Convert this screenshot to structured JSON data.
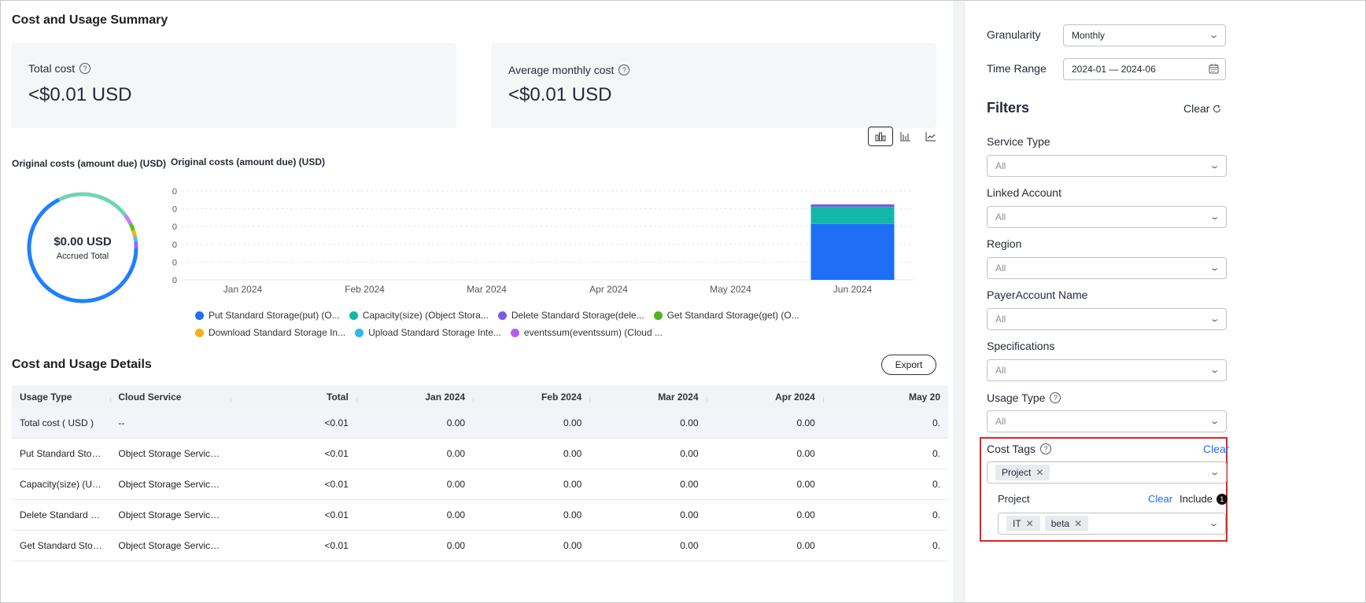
{
  "summary": {
    "title": "Cost and Usage Summary",
    "total_cost_label": "Total cost",
    "total_cost_value": "<$0.01 USD",
    "avg_cost_label": "Average monthly cost",
    "avg_cost_value": "<$0.01 USD"
  },
  "chart_switch": [
    "bar-chart-icon",
    "stacked-bar-icon",
    "line-chart-icon"
  ],
  "chart_data": [
    {
      "type": "pie",
      "title": "Original costs (amount due) (USD)",
      "center_value": "$0.00 USD",
      "center_label": "Accrued Total",
      "categories": [
        "Put Standard Storage(put) (O...",
        "Capacity(size) (Object Stora...",
        "Delete Standard Storage(dele...",
        "Get Standard Storage(get) (O...",
        "Download Standard Storage In...",
        "Upload Standard Storage Inte...",
        "eventssum(eventssum) (Cloud ..."
      ],
      "values": [
        68,
        22,
        3,
        2,
        2,
        1.5,
        1.5
      ],
      "colors": [
        "#1e80ff",
        "#6fd6b2",
        "#c77dfa",
        "#52c41a",
        "#faad14",
        "#4fc0f5",
        "#8f6cf5"
      ]
    },
    {
      "type": "bar",
      "title": "Original costs (amount due) (USD)",
      "categories": [
        "Jan 2024",
        "Feb 2024",
        "Mar 2024",
        "Apr 2024",
        "May 2024",
        "Jun 2024"
      ],
      "y_tick_labels": [
        "0",
        "0",
        "0",
        "0",
        "0",
        "0"
      ],
      "ylim": [
        0,
        100
      ],
      "series": [
        {
          "name": "Put Standard Storage(put) (O...",
          "color": "#1e6ff6",
          "values": [
            0,
            0,
            0,
            0,
            0,
            63
          ]
        },
        {
          "name": "Capacity(size) (Object Stora...",
          "color": "#13b7a8",
          "values": [
            0,
            0,
            0,
            0,
            0,
            19
          ]
        },
        {
          "name": "Delete Standard Storage(dele...",
          "color": "#7b5ce1",
          "values": [
            0,
            0,
            0,
            0,
            0,
            3
          ]
        },
        {
          "name": "Get Standard Storage(get) (O...",
          "color": "#52b31b",
          "values": [
            0,
            0,
            0,
            0,
            0,
            0
          ]
        },
        {
          "name": "Download Standard Storage In...",
          "color": "#faad14",
          "values": [
            0,
            0,
            0,
            0,
            0,
            0
          ]
        },
        {
          "name": "Upload Standard Storage Inte...",
          "color": "#34b6f0",
          "values": [
            0,
            0,
            0,
            0,
            0,
            0
          ]
        },
        {
          "name": "eventssum(eventssum) (Cloud ...",
          "color": "#b35ef2",
          "values": [
            0,
            0,
            0,
            0,
            0,
            0
          ]
        }
      ]
    }
  ],
  "details": {
    "title": "Cost and Usage Details",
    "export_label": "Export",
    "columns": [
      "Usage Type",
      "Cloud Service",
      "Total",
      "Jan 2024",
      "Feb 2024",
      "Mar 2024",
      "Apr 2024",
      "May 20"
    ],
    "rows": [
      [
        "Total cost ( USD )",
        "--",
        "<0.01",
        "0.00",
        "0.00",
        "0.00",
        "0.00",
        "0."
      ],
      [
        "Put Standard Stora...",
        "Object Storage Service (O...",
        "<0.01",
        "0.00",
        "0.00",
        "0.00",
        "0.00",
        "0."
      ],
      [
        "Capacity(size) (USD)",
        "Object Storage Service (O...",
        "<0.01",
        "0.00",
        "0.00",
        "0.00",
        "0.00",
        "0."
      ],
      [
        "Delete Standard St...",
        "Object Storage Service (O...",
        "<0.01",
        "0.00",
        "0.00",
        "0.00",
        "0.00",
        "0."
      ],
      [
        "Get Standard Stora...",
        "Object Storage Service (O...",
        "<0.01",
        "0.00",
        "0.00",
        "0.00",
        "0.00",
        "0."
      ]
    ]
  },
  "sidebar": {
    "granularity_label": "Granularity",
    "granularity_value": "Monthly",
    "time_range_label": "Time Range",
    "time_range_value": "2024-01 — 2024-06",
    "filters_title": "Filters",
    "clear_all": "Clear",
    "service_type_label": "Service Type",
    "linked_account_label": "Linked Account",
    "region_label": "Region",
    "payer_account_label": "PayerAccount Name",
    "specifications_label": "Specifications",
    "usage_type_label": "Usage Type",
    "all_value": "All",
    "cost_tags_label": "Cost Tags",
    "cost_tags_clear": "Clear",
    "cost_tag_chip": "Project",
    "project_label": "Project",
    "project_clear": "Clear",
    "project_include": "Include",
    "project_badge": "1",
    "project_chips": [
      "IT",
      "beta"
    ]
  }
}
